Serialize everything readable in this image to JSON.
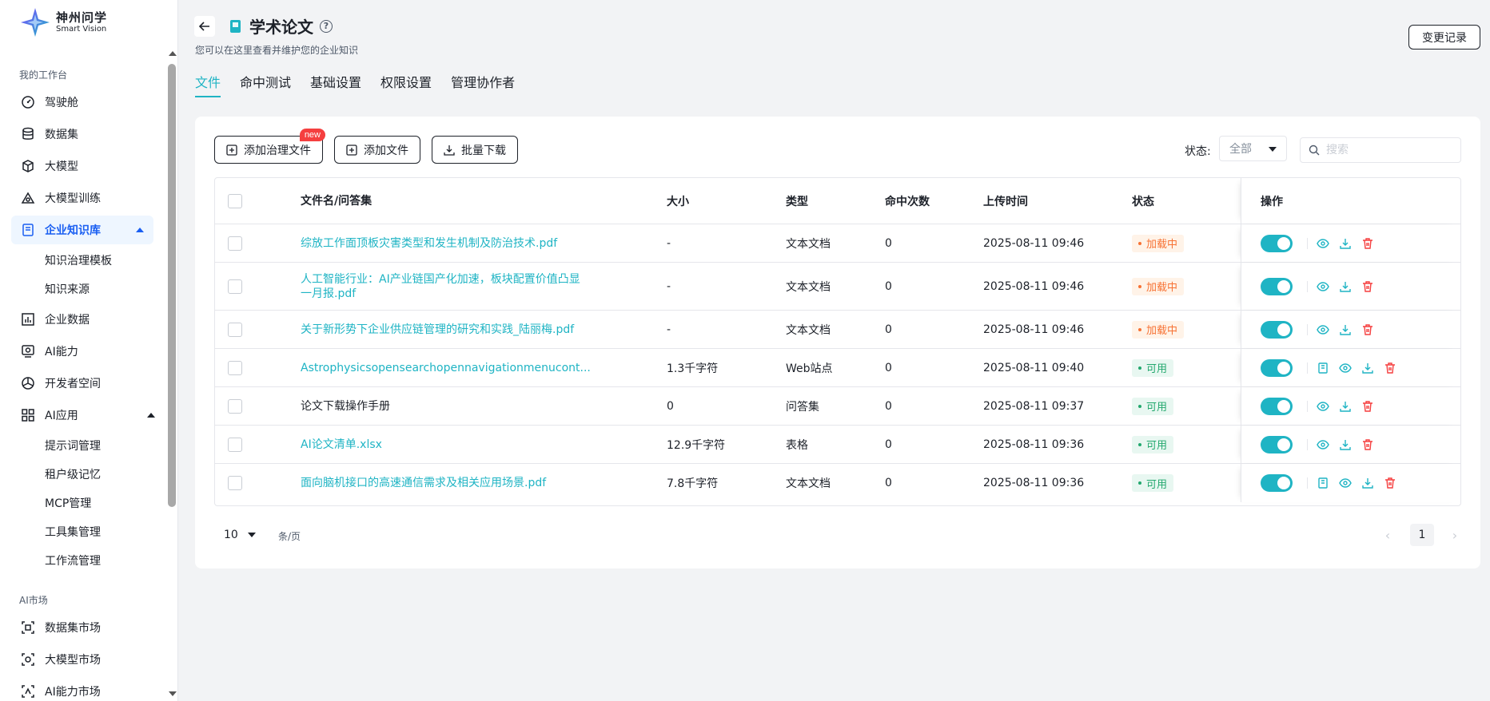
{
  "brand": {
    "title": "神州问学",
    "subtitle": "Smart Vision"
  },
  "sidebar": {
    "group_workbench": "我的工作台",
    "items": [
      {
        "label": "驾驶舱",
        "icon": "dashboard-icon"
      },
      {
        "label": "数据集",
        "icon": "database-icon"
      },
      {
        "label": "大模型",
        "icon": "cube-icon"
      },
      {
        "label": "大模型训练",
        "icon": "training-icon"
      },
      {
        "label": "企业知识库",
        "icon": "knowledge-base-icon",
        "active": true,
        "expanded": true
      },
      {
        "label": "企业数据",
        "icon": "bar-chart-icon"
      },
      {
        "label": "AI能力",
        "icon": "ai-capability-icon"
      },
      {
        "label": "开发者空间",
        "icon": "developer-icon"
      },
      {
        "label": "AI应用",
        "icon": "apps-grid-icon",
        "expanded": true
      }
    ],
    "kb_children": [
      "知识治理模板",
      "知识来源"
    ],
    "app_children": [
      "提示词管理",
      "租户级记忆",
      "MCP管理",
      "工具集管理",
      "工作流管理"
    ],
    "group_market": "AI市场",
    "market_items": [
      {
        "label": "数据集市场",
        "icon": "dataset-market-icon"
      },
      {
        "label": "大模型市场",
        "icon": "model-market-icon"
      },
      {
        "label": "AI能力市场",
        "icon": "ai-market-icon"
      }
    ]
  },
  "header": {
    "title": "学术论文",
    "subtitle": "您可以在这里查看并维护您的企业知识",
    "change_log": "变更记录"
  },
  "tabs": [
    {
      "label": "文件",
      "active": true
    },
    {
      "label": "命中测试"
    },
    {
      "label": "基础设置"
    },
    {
      "label": "权限设置"
    },
    {
      "label": "管理协作者"
    }
  ],
  "toolbar": {
    "add_governed": "添加治理文件",
    "new_badge": "new",
    "add_file": "添加文件",
    "batch_download": "批量下载",
    "status_label": "状态:",
    "status_value": "全部",
    "search_placeholder": "搜索"
  },
  "table": {
    "headers": {
      "name": "文件名/问答集",
      "size": "大小",
      "type": "类型",
      "hits": "命中次数",
      "upload_time": "上传时间",
      "status": "状态",
      "ops": "操作"
    },
    "rows": [
      {
        "name": "综放工作面顶板灾害类型和发生机制及防治技术.pdf",
        "size": "-",
        "type": "文本文档",
        "hits": "0",
        "time": "2025-08-11 09:46",
        "status": "加载中",
        "status_kind": "loading",
        "extra_op": false,
        "link": true,
        "tall": false
      },
      {
        "name": "人工智能行业：AI产业链国产化加速，板块配置价值凸显一月报.pdf",
        "size": "-",
        "type": "文本文档",
        "hits": "0",
        "time": "2025-08-11 09:46",
        "status": "加载中",
        "status_kind": "loading",
        "extra_op": false,
        "link": true,
        "tall": true
      },
      {
        "name": "关于新形势下企业供应链管理的研究和实践_陆丽梅.pdf",
        "size": "-",
        "type": "文本文档",
        "hits": "0",
        "time": "2025-08-11 09:46",
        "status": "加载中",
        "status_kind": "loading",
        "extra_op": false,
        "link": true,
        "tall": false
      },
      {
        "name": "Astrophysicsopensearchopennavigationmenucont...",
        "size": "1.3千字符",
        "type": "Web站点",
        "hits": "0",
        "time": "2025-08-11 09:40",
        "status": "可用",
        "status_kind": "available",
        "extra_op": true,
        "link": true,
        "tall": false
      },
      {
        "name": "论文下载操作手册",
        "size": "0",
        "type": "问答集",
        "hits": "0",
        "time": "2025-08-11 09:37",
        "status": "可用",
        "status_kind": "available",
        "extra_op": false,
        "link": false,
        "tall": false
      },
      {
        "name": "AI论文清单.xlsx",
        "size": "12.9千字符",
        "type": "表格",
        "hits": "0",
        "time": "2025-08-11 09:36",
        "status": "可用",
        "status_kind": "available",
        "extra_op": false,
        "link": true,
        "tall": false
      },
      {
        "name": "面向脑机接口的高速通信需求及相关应用场景.pdf",
        "size": "7.8千字符",
        "type": "文本文档",
        "hits": "0",
        "time": "2025-08-11 09:36",
        "status": "可用",
        "status_kind": "available",
        "extra_op": true,
        "link": true,
        "tall": false
      }
    ]
  },
  "pagination": {
    "page_size": "10",
    "unit": "条/页",
    "current": "1"
  },
  "colors": {
    "accent": "#1fb4c4",
    "active_nav": "#1a5ff2",
    "danger": "#f53f3f",
    "loading": "#f77234",
    "available": "#23a86e"
  }
}
